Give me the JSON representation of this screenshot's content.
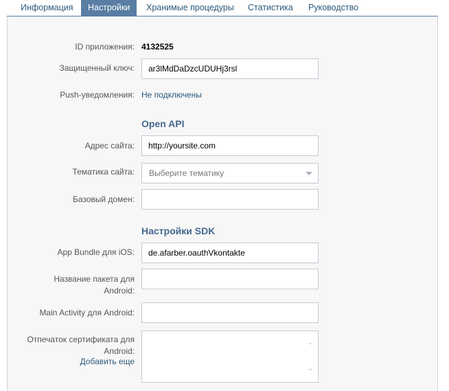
{
  "tabs": [
    {
      "label": "Информация",
      "active": false
    },
    {
      "label": "Настройки",
      "active": true
    },
    {
      "label": "Хранимые процедуры",
      "active": false
    },
    {
      "label": "Статистика",
      "active": false
    },
    {
      "label": "Руководство",
      "active": false
    }
  ],
  "settings": {
    "app_id": {
      "label": "ID приложения:",
      "value": "4132525"
    },
    "secret_key": {
      "label": "Защищенный ключ:",
      "value": "ar3lMdDaDzcUDUHj3rsl"
    },
    "push": {
      "label": "Push-уведомления:",
      "value": "Не подключены"
    },
    "open_api": {
      "title": "Open API",
      "site_address": {
        "label": "Адрес сайта:",
        "value": "http://yoursite.com"
      },
      "site_theme": {
        "label": "Тематика сайта:",
        "placeholder": "Выберите тематику"
      },
      "base_domain": {
        "label": "Базовый домен:",
        "value": ""
      }
    },
    "sdk": {
      "title": "Настройки SDK",
      "ios_bundle": {
        "label": "App Bundle для iOS:",
        "value": "de.afarber.oauthVkontakte"
      },
      "android_package": {
        "label_line1": "Название пакета для",
        "label_line2": "Android:",
        "value": ""
      },
      "android_main_activity": {
        "label": "Main Activity для Android:",
        "value": ""
      },
      "android_cert": {
        "label_line1": "Отпечаток сертификата для",
        "label_line2": "Android:",
        "add_more": "Добавить еще",
        "value": ""
      }
    }
  },
  "colors": {
    "accent": "#597da3",
    "link": "#2b587a",
    "section_title": "#45688e",
    "panel_bg": "#f7f7f7"
  }
}
